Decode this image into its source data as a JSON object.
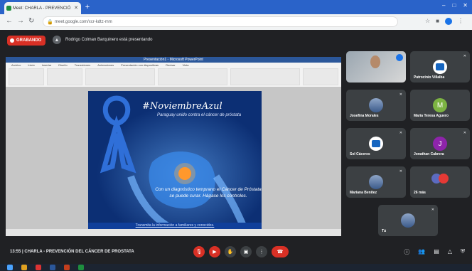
{
  "browser": {
    "tab_title": "Meet: CHARLA - PREVENCIÓ",
    "url": "meet.google.com/xcr-kdtz-mm"
  },
  "meet": {
    "recording_label": "GRABANDO",
    "presenter_text": "Rodrigo Colman Barquinero está presentando",
    "time": "13:55",
    "meeting_title": "CHARLA - PREVENCIÓN DEL CÁNCER DE PROSTATA"
  },
  "presentation": {
    "window_title": "Presentación1 - Microsoft PowerPoint",
    "slide": {
      "title": "#NoviembreAzul",
      "subtitle": "Paraguay unido contra el cáncer de próstata",
      "body": "Con un diagnóstico temprano el Cáncer de Próstata se puede curar. Hágase los controles.",
      "footer": "Transmita la información a familiares y conocidos."
    }
  },
  "participants": [
    {
      "name": "",
      "type": "camera"
    },
    {
      "name": "Patrocinio Villalba",
      "type": "logo"
    },
    {
      "name": "Josefina Morales",
      "type": "photo"
    },
    {
      "name": "María Teresa Aguero",
      "initial": "M",
      "color": "#7cb342"
    },
    {
      "name": "Sol Cáceres",
      "type": "logo"
    },
    {
      "name": "Jonathan Cabrera",
      "initial": "J",
      "color": "#8e24aa"
    },
    {
      "name": "Mariana Benítez",
      "type": "photo"
    },
    {
      "name": "26 más",
      "type": "more"
    },
    {
      "name": "Tú",
      "type": "photo"
    }
  ],
  "colors": {
    "meet_bg": "#202124",
    "record_red": "#d93025",
    "slide_blue": "#0c2f74"
  }
}
